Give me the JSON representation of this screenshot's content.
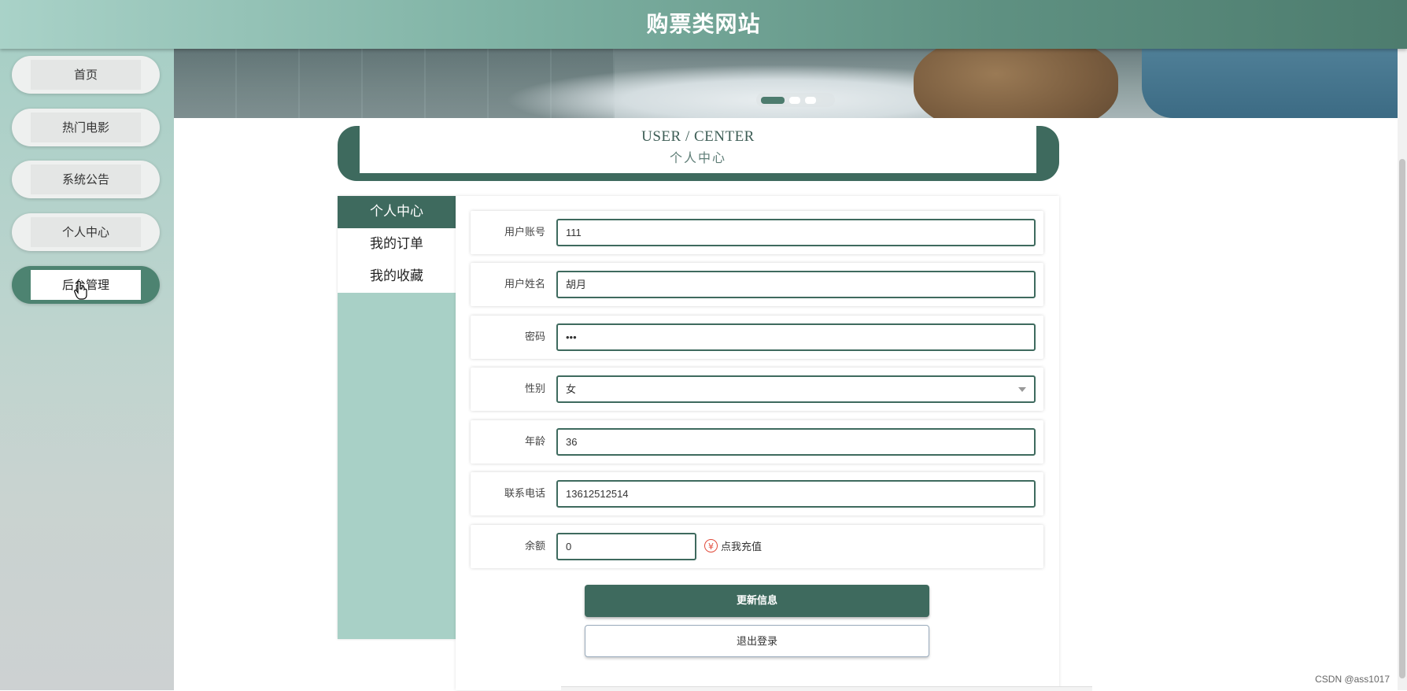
{
  "header": {
    "site_title": "购票类网站"
  },
  "sidebar": {
    "items": [
      {
        "label": "首页",
        "active": false
      },
      {
        "label": "热门电影",
        "active": false
      },
      {
        "label": "系统公告",
        "active": false
      },
      {
        "label": "个人中心",
        "active": false
      },
      {
        "label": "后台管理",
        "active": true
      }
    ]
  },
  "banner": {
    "slides_total": 3,
    "active_slide": 1
  },
  "user_center": {
    "title_en": "USER / CENTER",
    "title_cn": "个人中心"
  },
  "menu": {
    "items": [
      {
        "label": "个人中心",
        "active": true
      },
      {
        "label": "我的订单",
        "active": false
      },
      {
        "label": "我的收藏",
        "active": false
      }
    ]
  },
  "form": {
    "account": {
      "label": "用户账号",
      "value": "111"
    },
    "name": {
      "label": "用户姓名",
      "value": "胡月"
    },
    "password": {
      "label": "密码",
      "value": "•••"
    },
    "gender": {
      "label": "性别",
      "value": "女"
    },
    "age": {
      "label": "年龄",
      "value": "36"
    },
    "phone": {
      "label": "联系电话",
      "value": "13612512514"
    },
    "balance": {
      "label": "余额",
      "value": "0",
      "recharge_icon": "¥",
      "recharge_label": "点我充值"
    },
    "update_button": "更新信息",
    "logout_button": "退出登录"
  },
  "watermark": "CSDN @ass1017",
  "colors": {
    "primary": "#3e6a5e",
    "menu_bg": "#a8d0c6",
    "accent_red": "#e14b3b"
  }
}
